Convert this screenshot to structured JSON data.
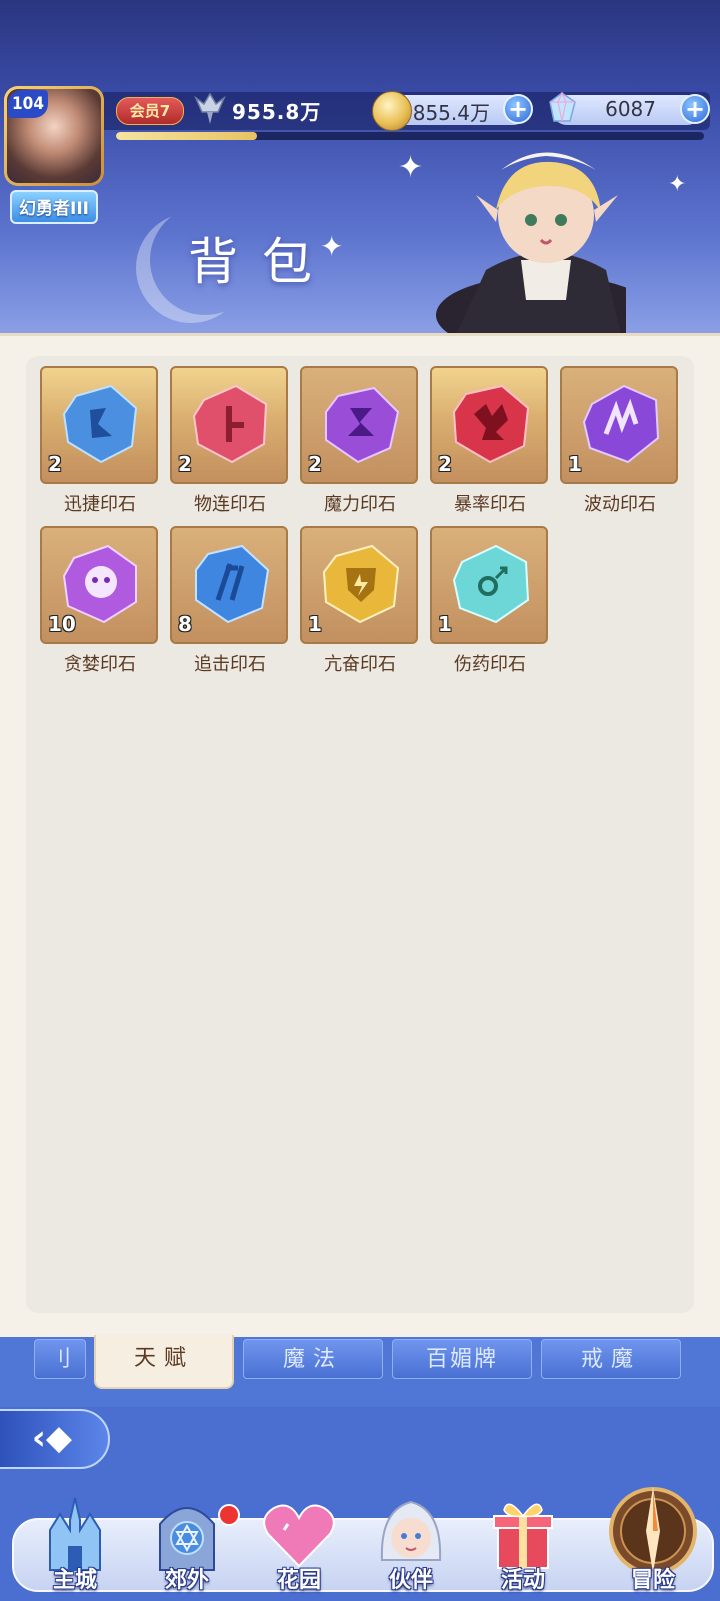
{
  "header": {
    "player_level": "104",
    "player_title": "幻勇者III",
    "vip_label": "会员7",
    "power": "955.8万",
    "exp_progress": 0.24,
    "coins": "855.4万",
    "gems": "6087",
    "page_title": "背包"
  },
  "items": [
    {
      "name": "迅捷印石",
      "count": "2",
      "color": "#4a8fe0"
    },
    {
      "name": "物连印石",
      "count": "2",
      "color": "#e0506a"
    },
    {
      "name": "魔力印石",
      "count": "2",
      "color": "#9a4ed8"
    },
    {
      "name": "暴率印石",
      "count": "2",
      "color": "#d8344a"
    },
    {
      "name": "波动印石",
      "count": "1",
      "color": "#8a48d8"
    },
    {
      "name": "贪婪印石",
      "count": "10",
      "color": "#b05ae0"
    },
    {
      "name": "追击印石",
      "count": "8",
      "color": "#3f86e0"
    },
    {
      "name": "亢奋印石",
      "count": "1",
      "color": "#e9b83a"
    },
    {
      "name": "伤药印石",
      "count": "1",
      "color": "#6dd6d6"
    }
  ],
  "tabs": [
    {
      "label": "刂"
    },
    {
      "label": "天赋"
    },
    {
      "label": "魔法"
    },
    {
      "label": "百媚牌"
    },
    {
      "label": "戒魔"
    }
  ],
  "bottom_nav": [
    {
      "label": "主城"
    },
    {
      "label": "郊外"
    },
    {
      "label": "花园"
    },
    {
      "label": "伙伴"
    },
    {
      "label": "活动"
    },
    {
      "label": "冒险"
    }
  ]
}
